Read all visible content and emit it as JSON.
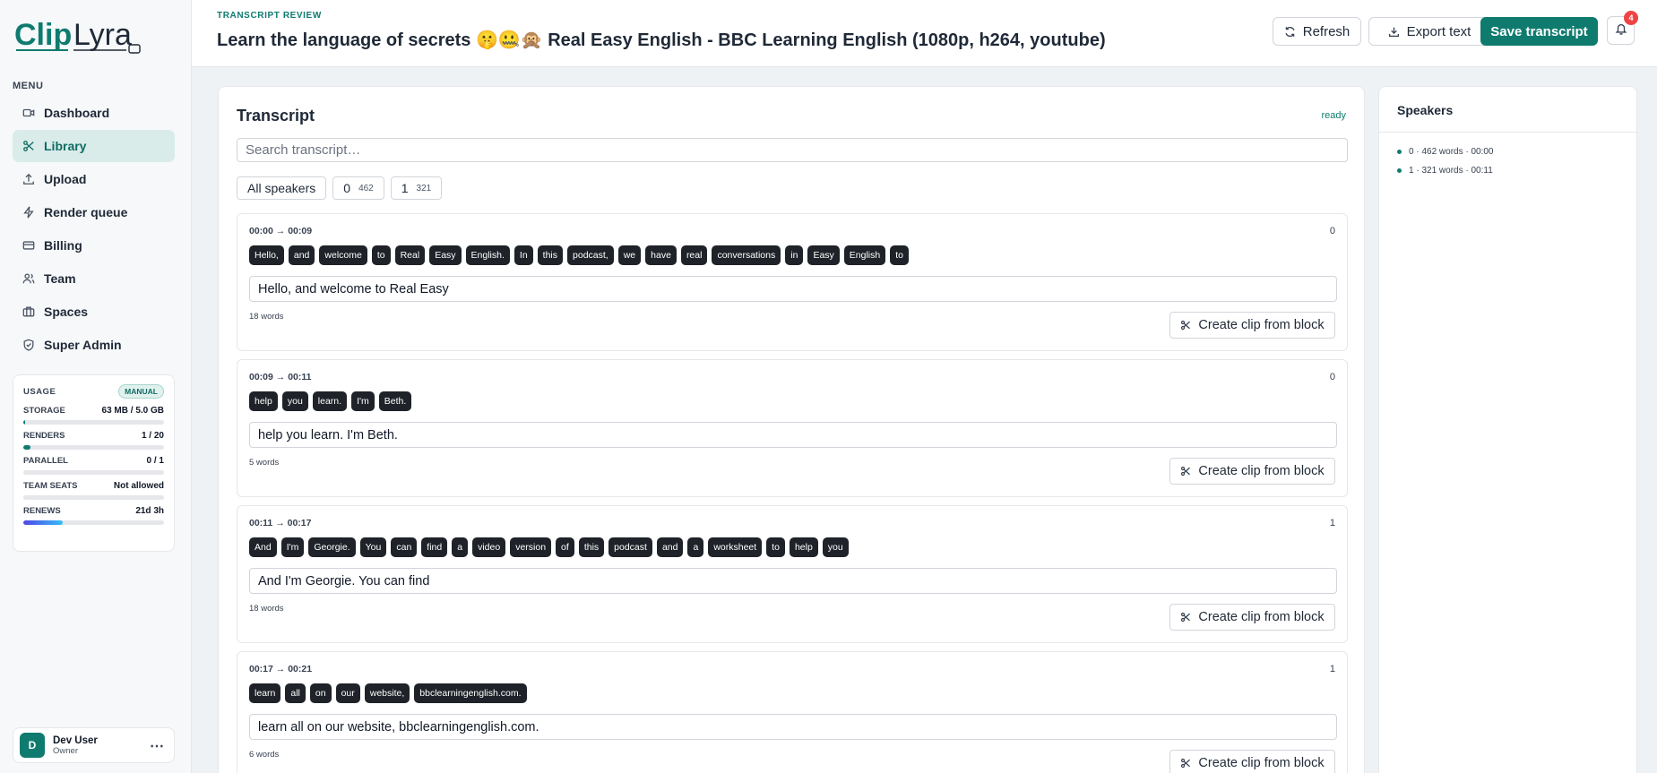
{
  "app": {
    "brand": "ClipLyra"
  },
  "sidebar": {
    "menu_label": "MENU",
    "items": [
      {
        "label": "Dashboard",
        "icon": "video-icon",
        "active": false
      },
      {
        "label": "Library",
        "icon": "scissors-icon",
        "active": true
      },
      {
        "label": "Upload",
        "icon": "upload-icon",
        "active": false
      },
      {
        "label": "Render queue",
        "icon": "bolt-icon",
        "active": false
      },
      {
        "label": "Billing",
        "icon": "card-icon",
        "active": false
      },
      {
        "label": "Team",
        "icon": "users-icon",
        "active": false
      },
      {
        "label": "Spaces",
        "icon": "briefcase-icon",
        "active": false
      },
      {
        "label": "Super Admin",
        "icon": "shield-icon",
        "active": false
      }
    ],
    "usage": {
      "title": "USAGE",
      "plan_badge": "MANUAL",
      "rows": [
        {
          "label": "STORAGE",
          "value": "63 MB / 5.0 GB",
          "fraction": 0.012
        },
        {
          "label": "RENDERS",
          "value": "1 / 20",
          "fraction": 0.05
        },
        {
          "label": "PARALLEL",
          "value": "0 / 1",
          "fraction": 0
        },
        {
          "label": "TEAM SEATS",
          "value": "Not allowed",
          "fraction": 0
        },
        {
          "label": "RENEWS",
          "value": "21d 3h",
          "fraction": 0.28
        }
      ]
    },
    "user": {
      "initial": "D",
      "name": "Dev User",
      "role": "Owner",
      "more": "⋯"
    }
  },
  "header": {
    "eyebrow": "TRANSCRIPT REVIEW",
    "title": "Learn the language of secrets 🤫🤐🙊 Real Easy English - BBC Learning English (1080p, h264, youtube)",
    "refresh_label": "Refresh",
    "export_label": "Export text",
    "save_label": "Save transcript",
    "notifications_count": "4"
  },
  "transcript": {
    "title": "Transcript",
    "status": "ready",
    "search_placeholder": "Search transcript…",
    "filters": {
      "all": "All speakers",
      "speakers": [
        {
          "id": "0",
          "count": "462"
        },
        {
          "id": "1",
          "count": "321"
        }
      ]
    },
    "clip_label": "Create clip from block",
    "blocks": [
      {
        "time": "00:00 → 00:09",
        "speaker": "0",
        "words": [
          "Hello,",
          "and",
          "welcome",
          "to",
          "Real",
          "Easy",
          "English.",
          "In",
          "this",
          "podcast,",
          "we",
          "have",
          "real",
          "conversations",
          "in",
          "Easy",
          "English",
          "to"
        ],
        "text": "Hello, and welcome to Real Easy",
        "word_count": "18 words"
      },
      {
        "time": "00:09 → 00:11",
        "speaker": "0",
        "words": [
          "help",
          "you",
          "learn.",
          "I'm",
          "Beth."
        ],
        "text": "help you learn. I'm Beth.",
        "word_count": "5 words"
      },
      {
        "time": "00:11 → 00:17",
        "speaker": "1",
        "words": [
          "And",
          "I'm",
          "Georgie.",
          "You",
          "can",
          "find",
          "a",
          "video",
          "version",
          "of",
          "this",
          "podcast",
          "and",
          "a",
          "worksheet",
          "to",
          "help",
          "you"
        ],
        "text": "And I'm Georgie. You can find",
        "word_count": "18 words"
      },
      {
        "time": "00:17 → 00:21",
        "speaker": "1",
        "words": [
          "learn",
          "all",
          "on",
          "our",
          "website,",
          "bbclearningenglish.com."
        ],
        "text": "learn all on our website, bbclearningenglish.com.",
        "word_count": "6 words"
      }
    ]
  },
  "speakers_panel": {
    "title": "Speakers",
    "items": [
      "0 · 462 words · 00:00",
      "1 · 321 words · 00:11"
    ]
  },
  "colors": {
    "accent": "#0f7b6f",
    "chip": "#1f2329",
    "badge": "#ef4444"
  }
}
